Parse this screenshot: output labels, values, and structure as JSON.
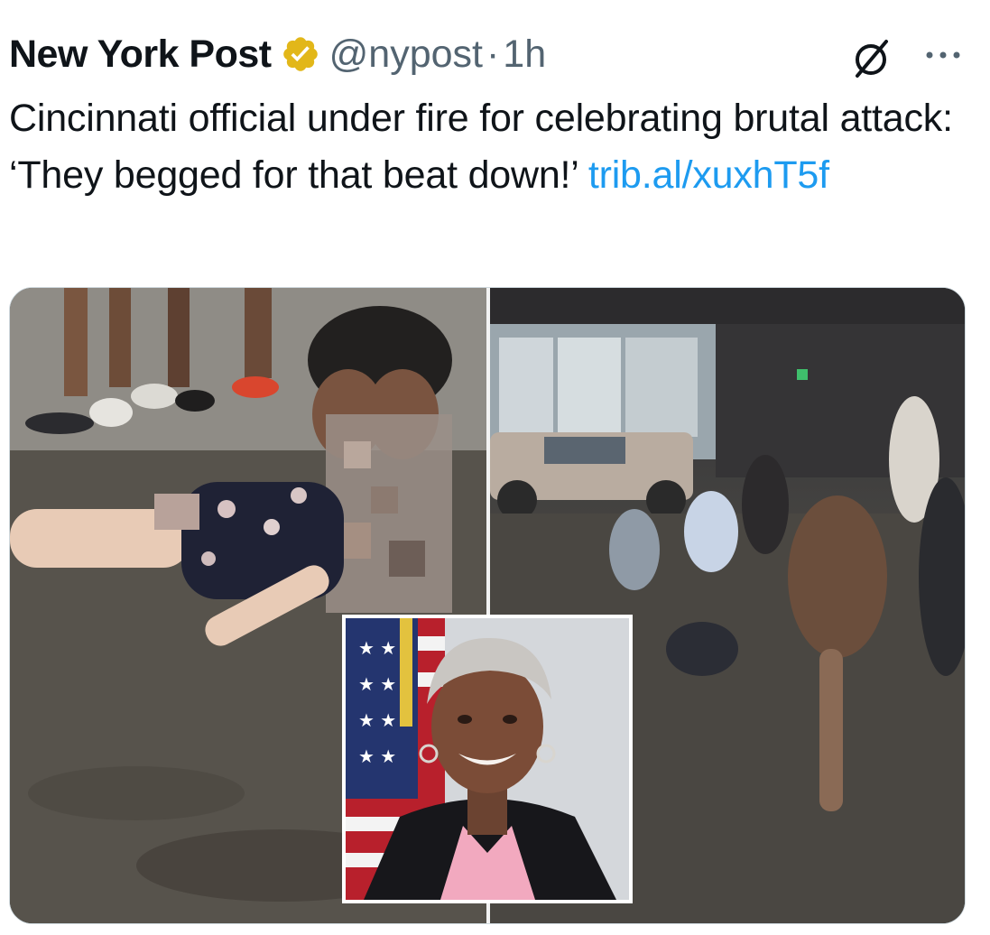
{
  "tweet": {
    "display_name": "New York Post",
    "handle": "@nypost",
    "separator": "·",
    "time": "1h",
    "text": "Cincinnati official under fire for celebrating brutal attack: ‘They begged for that beat down!’",
    "link": "trib.al/xuxhT5f"
  },
  "icons": {
    "verified": "verified-badge-icon",
    "grok": "grok-icon",
    "more": "more-options-icon"
  },
  "colors": {
    "verified_badge": "#e2b719",
    "link": "#1d9bf0",
    "secondary_text": "#536471"
  },
  "media": {
    "panels": [
      "left-scene-photo",
      "right-scene-photo",
      "inset-portrait-photo"
    ]
  }
}
